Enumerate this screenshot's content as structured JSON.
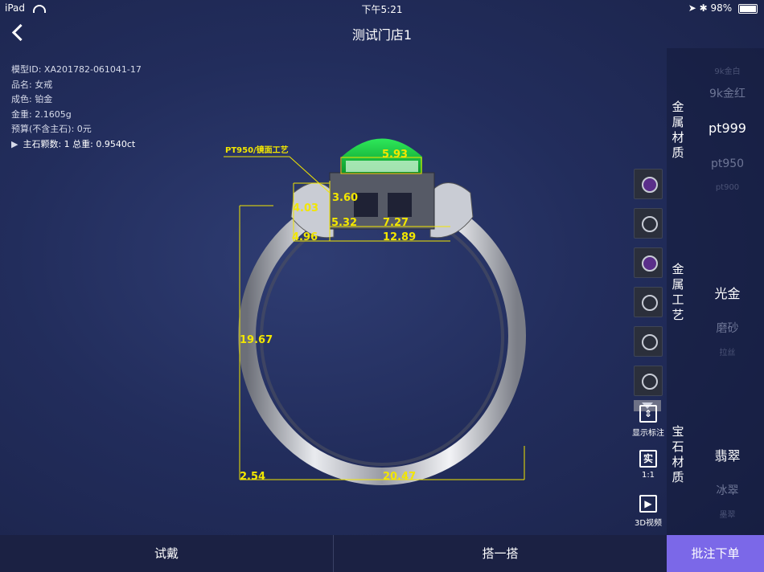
{
  "status": {
    "device": "iPad",
    "time": "下午5:21",
    "battery": "98%",
    "battery_level": 0.98
  },
  "nav": {
    "title": "测试门店1"
  },
  "info": {
    "model_id": "模型ID: XA201782-061041-17",
    "name": "品名: 女戒",
    "color": "成色: 铂金",
    "weight": "金重: 2.1605g",
    "budget": "预算(不含主石): 0元",
    "main_stone": "主石颗数: 1  总重: 0.9540ct"
  },
  "annotations": {
    "craft": "PT950/镜面工艺",
    "d1": "5.93",
    "d2": "3.60",
    "d3": "4.03",
    "d4": "5.32",
    "d5": "7.27",
    "d6": "4.96",
    "d7": "12.89",
    "d8": "19.67",
    "d9": "2.54",
    "d10": "20.47"
  },
  "tools": {
    "show_labels": "显示标注",
    "ratio_icon": "实",
    "ratio": "1:1",
    "video": "3D视频"
  },
  "panel": {
    "metal_material": {
      "title": "金属材质",
      "options": [
        "9k金白",
        "9k金红",
        "pt999",
        "pt950",
        "pt900"
      ]
    },
    "metal_craft": {
      "title": "金属工艺",
      "options": [
        "光金",
        "磨砂",
        "拉丝"
      ]
    },
    "gem_material": {
      "title": "宝石材质",
      "options": [
        "翡翠",
        "冰翠",
        "墨翠"
      ]
    }
  },
  "bottom": {
    "try_on": "试戴",
    "match": "搭一搭",
    "order": "批注下单"
  },
  "colors": {
    "accent": "#7b68e8",
    "annotation": "#f2e600",
    "gem": "#18d040"
  }
}
